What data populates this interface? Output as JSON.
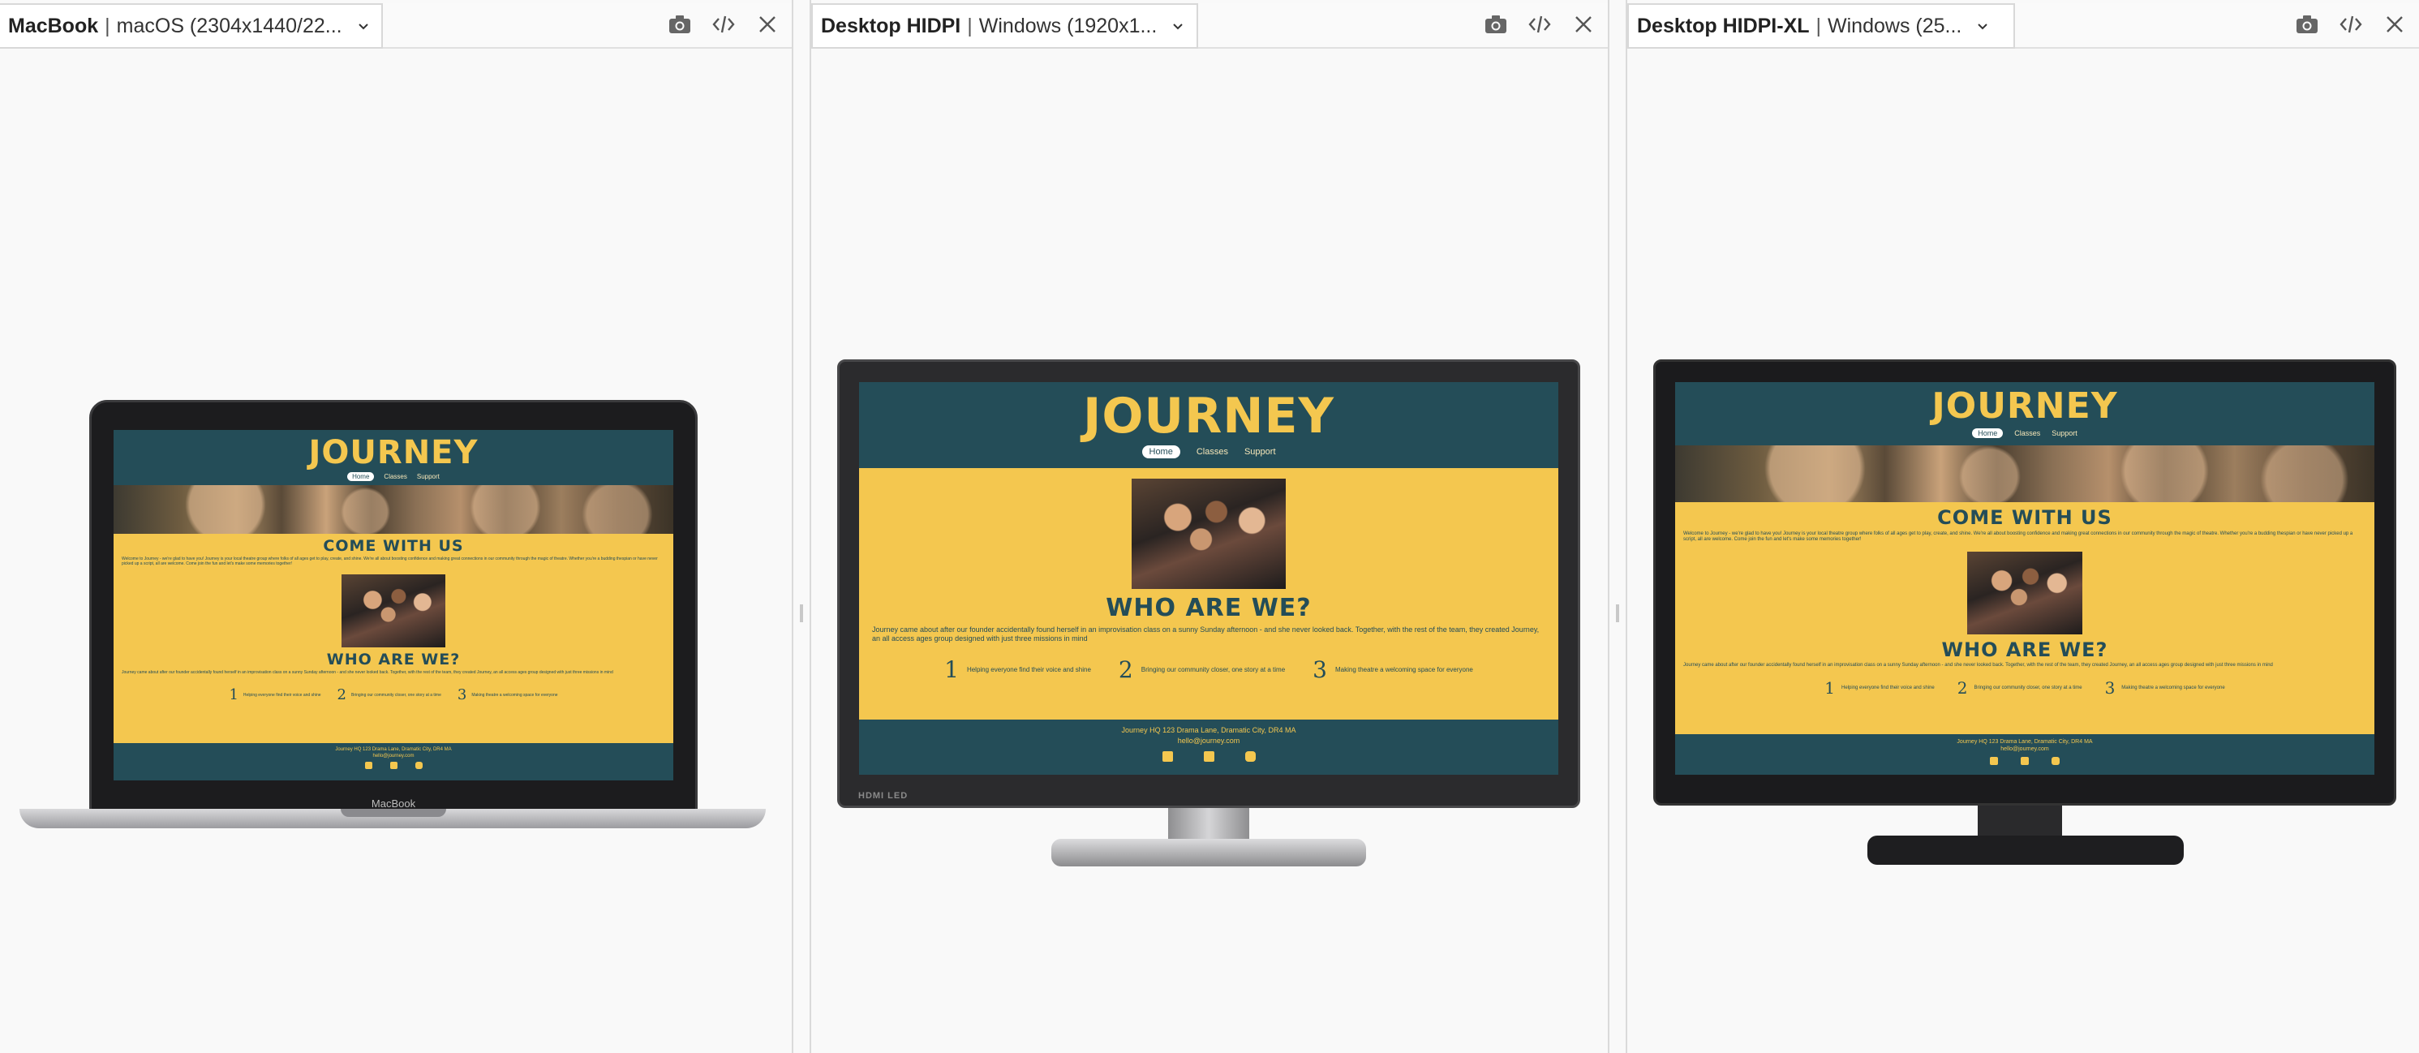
{
  "panels": [
    {
      "device": "MacBook",
      "spec": "macOS (2304x1440/22...",
      "laptop_label": "MacBook"
    },
    {
      "device": "Desktop HIDPI",
      "spec": "Windows (1920x1...",
      "monitor_label": "HDMI  LED"
    },
    {
      "device": "Desktop HIDPI-XL",
      "spec": "Windows (25..."
    }
  ],
  "site": {
    "logo": "JOURNEY",
    "nav": [
      "Home",
      "Classes",
      "Support"
    ],
    "come_title": "COME WITH US",
    "come_text": "Welcome to Journey - we're glad to have you! Journey is your local theatre group where folks of all ages get to play, create, and shine. We're all about boosting confidence and making great connections in our community through the magic of theatre. Whether you're a budding thespian or have never picked up a script, all are welcome. Come join the fun and let's make some memories together!",
    "who_title": "WHO ARE WE?",
    "who_text": "Journey came about after our founder accidentally found herself in an improvisation class on a sunny Sunday afternoon - and she never looked back. Together, with the rest of the team, they created Journey, an all access ages group designed with just three missions in mind",
    "missions": [
      {
        "num": "1",
        "text": "Helping everyone find their voice and shine"
      },
      {
        "num": "2",
        "text": "Bringing our community closer, one story at a time"
      },
      {
        "num": "3",
        "text": "Making theatre a welcoming space for everyone"
      }
    ],
    "footer_address": "Journey HQ 123 Drama Lane, Dramatic City, DR4 MA",
    "footer_email": "hello@journey.com"
  },
  "icons": [
    "camera-icon",
    "code-icon",
    "close-icon",
    "chevron-down-icon",
    "facebook-icon",
    "x-icon",
    "instagram-icon"
  ],
  "colors": {
    "site_teal": "#244d58",
    "site_yellow": "#f4c74f"
  }
}
